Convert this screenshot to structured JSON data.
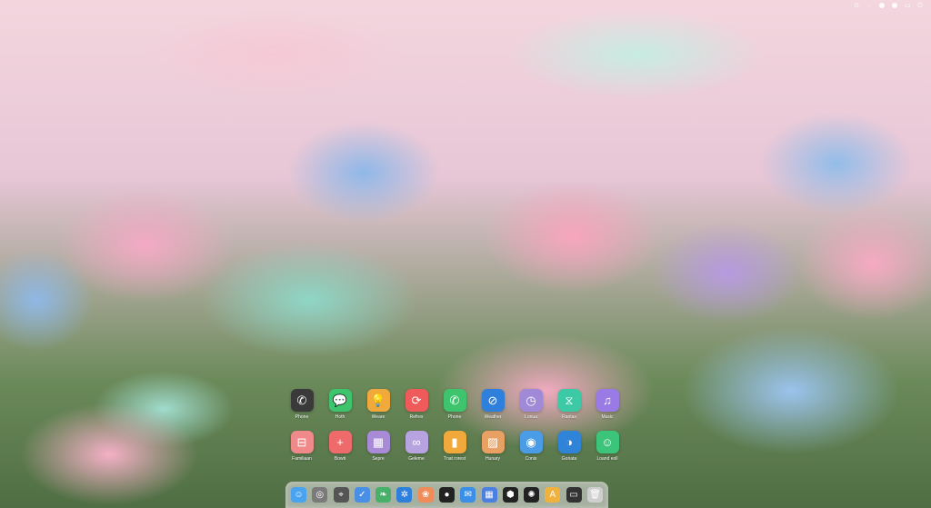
{
  "colors": {
    "tile_dark": "#3a3a3a",
    "tile_green": "#3ec46d",
    "tile_orange": "#f2a93b",
    "tile_red": "#ef5a5a",
    "tile_blue": "#2f7fdc",
    "tile_purple": "#a08ad8",
    "tile_teal": "#3cc9a6",
    "tile_violet": "#9a7be6"
  },
  "menubar": {
    "icons": [
      "record-icon",
      "chat-icon",
      "dot-icon",
      "dot-icon",
      "battery-icon",
      "power-icon"
    ]
  },
  "apps": {
    "row1": [
      {
        "icon": "phone-icon",
        "label": "Phone",
        "glyph": "✆",
        "color": "#3a3a3a"
      },
      {
        "icon": "messages-icon",
        "label": "Hoth",
        "glyph": "💬",
        "color": "#3ec46d"
      },
      {
        "icon": "tips-icon",
        "label": "Weare",
        "glyph": "💡",
        "color": "#f2a93b"
      },
      {
        "icon": "refresh-icon",
        "label": "Refres",
        "glyph": "⟳",
        "color": "#ef5a5a"
      },
      {
        "icon": "call-icon",
        "label": "Phone",
        "glyph": "✆",
        "color": "#3ec46d"
      },
      {
        "icon": "compass-icon",
        "label": "Weather",
        "glyph": "⊘",
        "color": "#2f7fdc"
      },
      {
        "icon": "clock-icon",
        "label": "Lonua",
        "glyph": "◷",
        "color": "#a08ad8"
      },
      {
        "icon": "hourglass-icon",
        "label": "Rantas",
        "glyph": "⧖",
        "color": "#3cc9a6"
      },
      {
        "icon": "music-icon",
        "label": "Music",
        "glyph": "♫",
        "color": "#9a7be6"
      }
    ],
    "row2": [
      {
        "icon": "car-icon",
        "label": "Familiaan",
        "glyph": "⊟",
        "color": "#f08a8a"
      },
      {
        "icon": "plus-icon",
        "label": "Bowti",
        "glyph": "+",
        "color": "#ef6b6b"
      },
      {
        "icon": "calendar-icon",
        "label": "Sepre",
        "glyph": "▦",
        "color": "#a88ad6"
      },
      {
        "icon": "link-icon",
        "label": "Geleme",
        "glyph": "∞",
        "color": "#b6a3e0"
      },
      {
        "icon": "chart-icon",
        "label": "Tnat rorest",
        "glyph": "▮",
        "color": "#f2a93b"
      },
      {
        "icon": "photo-icon",
        "label": "Hunary",
        "glyph": "▨",
        "color": "#e9a063"
      },
      {
        "icon": "steering-icon",
        "label": "Conis",
        "glyph": "◉",
        "color": "#4a9ce6"
      },
      {
        "icon": "globe-icon",
        "label": "Goriata",
        "glyph": "◑",
        "color": "#2f84d8"
      },
      {
        "icon": "smile-icon",
        "label": "Loand eoll",
        "glyph": "☺",
        "color": "#3cc47a"
      }
    ]
  },
  "dock": [
    {
      "icon": "finder-icon",
      "glyph": "☺",
      "color": "#4aa3ef"
    },
    {
      "icon": "safari-icon",
      "glyph": "◎",
      "color": "#7a7a7a"
    },
    {
      "icon": "location-icon",
      "glyph": "⌖",
      "color": "#555555"
    },
    {
      "icon": "check-icon",
      "glyph": "✓",
      "color": "#4a8fe6"
    },
    {
      "icon": "leaf-icon",
      "glyph": "❧",
      "color": "#49b06a"
    },
    {
      "icon": "gear-icon",
      "glyph": "✲",
      "color": "#2f7fdc"
    },
    {
      "icon": "photos-icon",
      "glyph": "❀",
      "color": "#f08c5a"
    },
    {
      "icon": "record-icon",
      "glyph": "●",
      "color": "#222222"
    },
    {
      "icon": "mail-icon",
      "glyph": "✉",
      "color": "#3b8fe6"
    },
    {
      "icon": "calendar-icon",
      "glyph": "▦",
      "color": "#4b7fe0"
    },
    {
      "icon": "hexagon-icon",
      "glyph": "⬢",
      "color": "#222222"
    },
    {
      "icon": "settings-icon",
      "glyph": "✺",
      "color": "#222222"
    },
    {
      "icon": "text-icon",
      "glyph": "A",
      "color": "#f0b23c"
    },
    {
      "icon": "screen-icon",
      "glyph": "▭",
      "color": "#333333"
    },
    {
      "icon": "trash-icon",
      "glyph": "🗑",
      "color": "#cfcfcf"
    }
  ]
}
